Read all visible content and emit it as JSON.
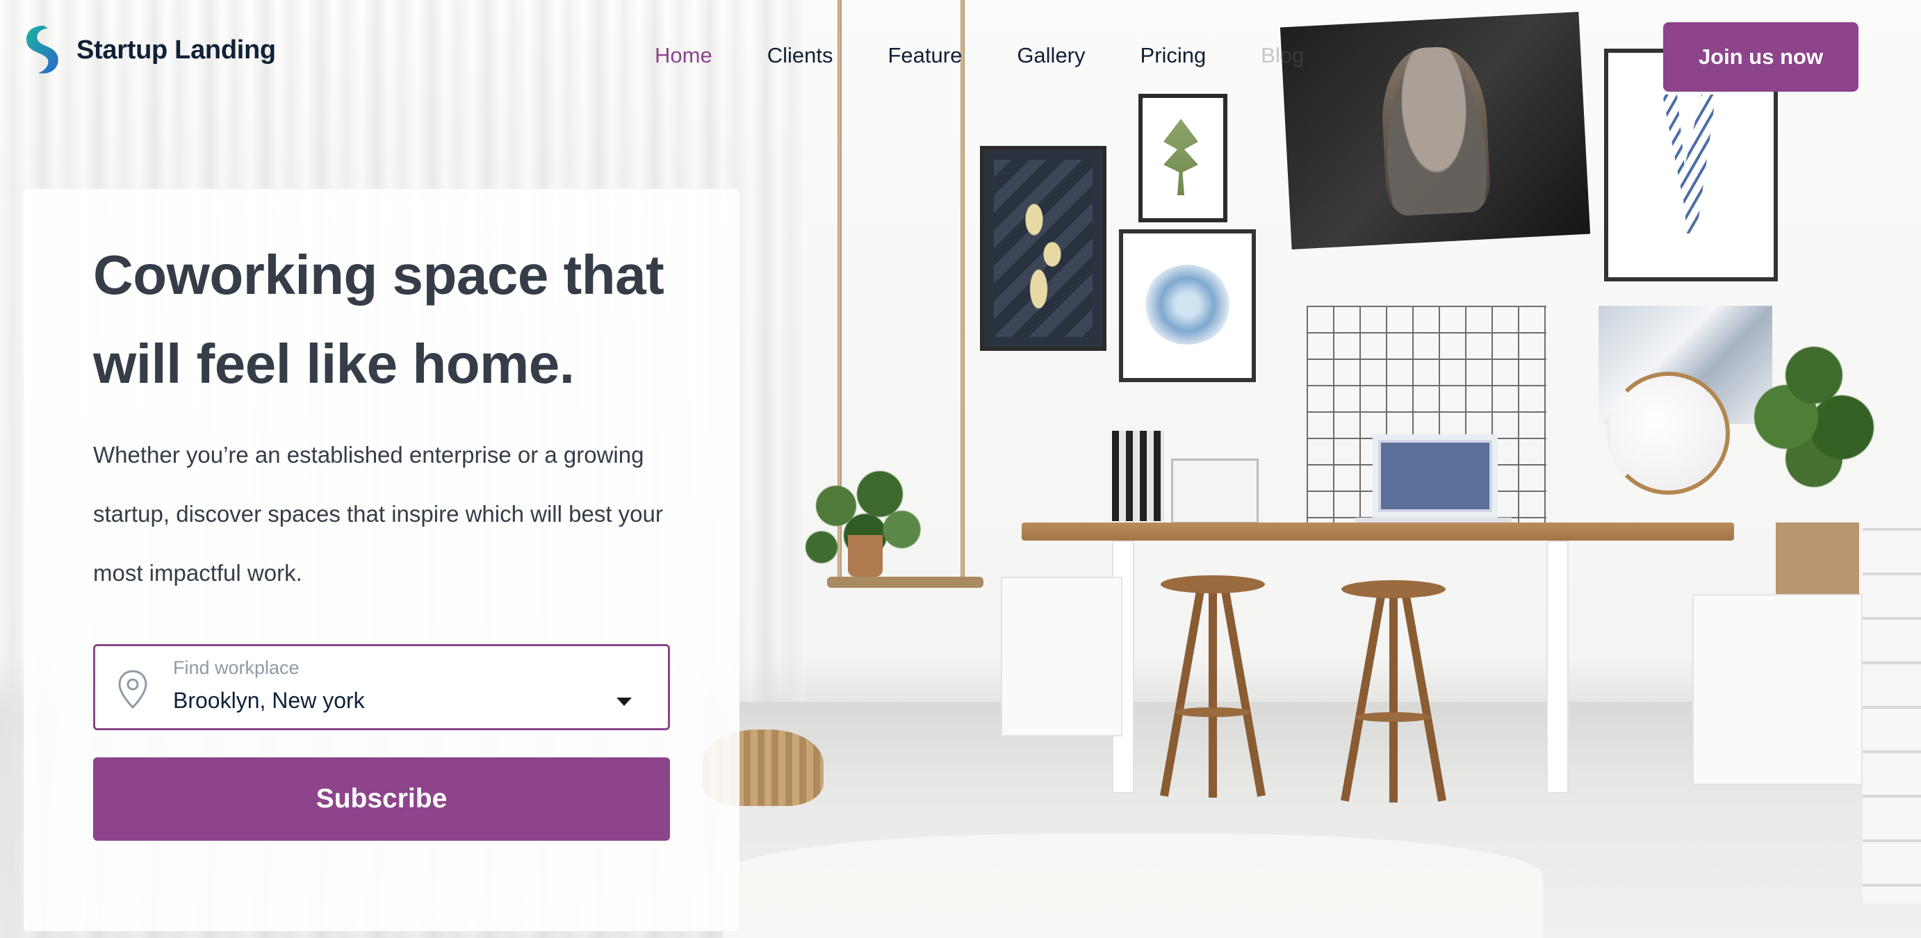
{
  "brand": {
    "name": "Startup Landing",
    "accent_color": "#8d448b",
    "logo_colors": [
      "#1fb3a0",
      "#2768c9"
    ]
  },
  "nav": {
    "items": [
      {
        "label": "Home",
        "active": true
      },
      {
        "label": "Clients",
        "active": false
      },
      {
        "label": "Feature",
        "active": false
      },
      {
        "label": "Gallery",
        "active": false
      },
      {
        "label": "Pricing",
        "active": false
      },
      {
        "label": "Blog",
        "active": false
      }
    ],
    "cta_label": "Join us now"
  },
  "hero": {
    "title": "Coworking space that will feel like home.",
    "description": "Whether you’re an established enterprise or a growing startup, discover spaces that inspire which will best your most impactful work.",
    "location_field": {
      "label": "Find workplace",
      "value": "Brooklyn, New york",
      "icon": "map-pin-icon"
    },
    "subscribe_label": "Subscribe"
  }
}
